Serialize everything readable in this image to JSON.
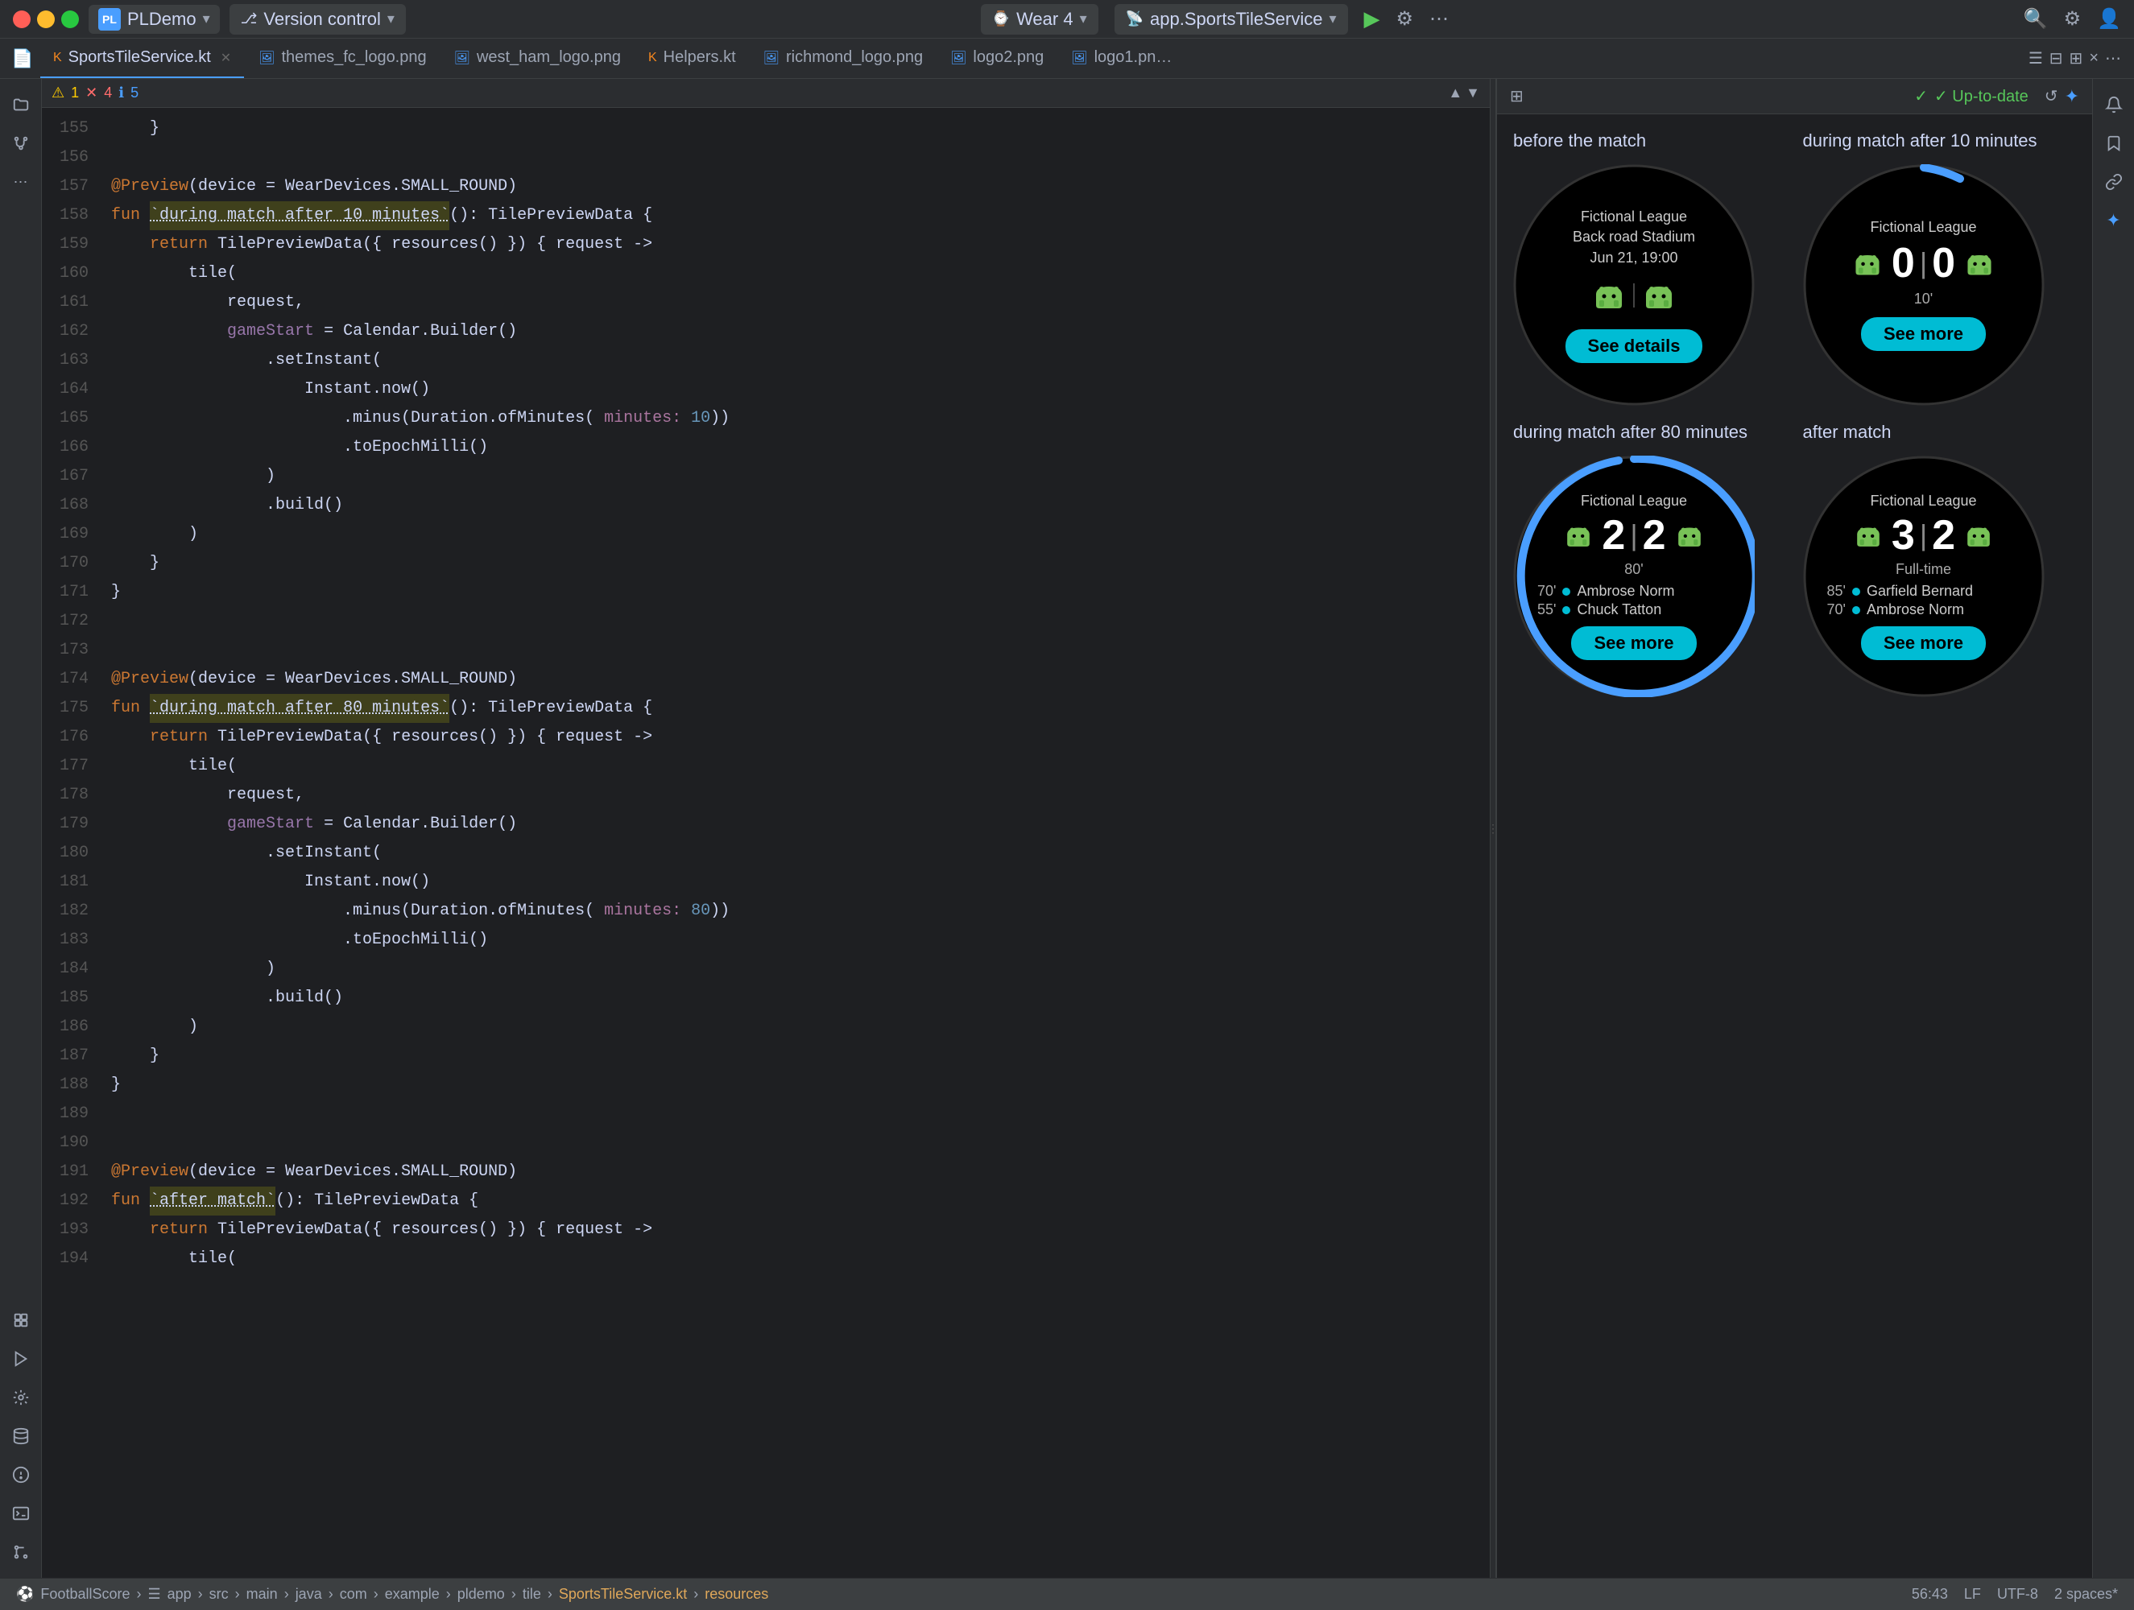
{
  "titlebar": {
    "traffic_lights": [
      "red",
      "yellow",
      "green"
    ],
    "project_label": "PLDemo",
    "version_control_label": "Version control",
    "wear_label": "Wear 4",
    "service_label": "app.SportsTileService",
    "run_icon": "▶",
    "debug_icon": "⚙",
    "more_icon": "⋯"
  },
  "tabs": [
    {
      "label": "SportsTileService.kt",
      "active": true,
      "closable": true,
      "icon": "kotlin"
    },
    {
      "label": "themes_fc_logo.png",
      "active": false,
      "closable": false,
      "icon": "image"
    },
    {
      "label": "west_ham_logo.png",
      "active": false,
      "closable": false,
      "icon": "image"
    },
    {
      "label": "Helpers.kt",
      "active": false,
      "closable": false,
      "icon": "kotlin"
    },
    {
      "label": "richmond_logo.png",
      "active": false,
      "closable": false,
      "icon": "image"
    },
    {
      "label": "logo2.png",
      "active": false,
      "closable": false,
      "icon": "image"
    },
    {
      "label": "logo1.pn…",
      "active": false,
      "closable": false,
      "icon": "image"
    }
  ],
  "editor": {
    "warnings": "1",
    "errors": "4",
    "infos": "5",
    "lines": [
      {
        "num": "155",
        "code": "    }",
        "tokens": [
          {
            "text": "    }",
            "class": "kw-normal"
          }
        ]
      },
      {
        "num": "156",
        "code": "",
        "tokens": []
      },
      {
        "num": "157",
        "code": "@Preview(device = WearDevices.SMALL_ROUND)",
        "tokens": [
          {
            "text": "@Preview",
            "class": "kw-annotation"
          },
          {
            "text": "(device = WearDevices.SMALL_ROUND)",
            "class": "kw-normal"
          }
        ]
      },
      {
        "num": "158",
        "code": "fun `during match after 10 minutes`(): TilePreviewData {",
        "tokens": [
          {
            "text": "fun",
            "class": "kw-fun"
          },
          {
            "text": " ",
            "class": "kw-normal"
          },
          {
            "text": "`during match after 10 minutes`",
            "class": "kw-highlight"
          },
          {
            "text": "(): TilePreviewData {",
            "class": "kw-normal"
          }
        ]
      },
      {
        "num": "159",
        "code": "    return TilePreviewData({ resources() }) { request ->",
        "tokens": [
          {
            "text": "    ",
            "class": "kw-normal"
          },
          {
            "text": "return",
            "class": "kw-return"
          },
          {
            "text": " TilePreviewData({ resources() }) { request ->",
            "class": "kw-normal"
          }
        ]
      },
      {
        "num": "160",
        "code": "        tile(",
        "tokens": [
          {
            "text": "        tile(",
            "class": "kw-normal"
          }
        ]
      },
      {
        "num": "161",
        "code": "            request,",
        "tokens": [
          {
            "text": "            request,",
            "class": "kw-normal"
          }
        ]
      },
      {
        "num": "162",
        "code": "            gameStart = Calendar.Builder()",
        "tokens": [
          {
            "text": "            ",
            "class": "kw-normal"
          },
          {
            "text": "gameStart",
            "class": "kw-param-name"
          },
          {
            "text": " = Calendar.Builder()",
            "class": "kw-normal"
          }
        ]
      },
      {
        "num": "163",
        "code": "                .setInstant(",
        "tokens": [
          {
            "text": "                .setInstant(",
            "class": "kw-normal"
          }
        ]
      },
      {
        "num": "164",
        "code": "                    Instant.now()",
        "tokens": [
          {
            "text": "                    Instant.now()",
            "class": "kw-normal"
          }
        ]
      },
      {
        "num": "165",
        "code": "                        .minus(Duration.ofMinutes( minutes: 10))",
        "tokens": [
          {
            "text": "                        .minus(Duration.ofMinutes(",
            "class": "kw-normal"
          },
          {
            "text": " minutes:",
            "class": "kw-param-label"
          },
          {
            "text": " 10",
            "class": "kw-number"
          },
          {
            "text": "))",
            "class": "kw-normal"
          }
        ]
      },
      {
        "num": "166",
        "code": "                        .toEpochMilli()",
        "tokens": [
          {
            "text": "                        .toEpochMilli()",
            "class": "kw-normal"
          }
        ]
      },
      {
        "num": "167",
        "code": "                )",
        "tokens": [
          {
            "text": "                )",
            "class": "kw-normal"
          }
        ]
      },
      {
        "num": "168",
        "code": "                .build()",
        "tokens": [
          {
            "text": "                .build()",
            "class": "kw-normal"
          }
        ]
      },
      {
        "num": "169",
        "code": "        )",
        "tokens": [
          {
            "text": "        )",
            "class": "kw-normal"
          }
        ]
      },
      {
        "num": "170",
        "code": "    }",
        "tokens": [
          {
            "text": "    }",
            "class": "kw-normal"
          }
        ]
      },
      {
        "num": "171",
        "code": "}",
        "tokens": [
          {
            "text": "}",
            "class": "kw-normal"
          }
        ]
      },
      {
        "num": "172",
        "code": "",
        "tokens": []
      },
      {
        "num": "173",
        "code": "",
        "tokens": []
      },
      {
        "num": "174",
        "code": "@Preview(device = WearDevices.SMALL_ROUND)",
        "tokens": [
          {
            "text": "@Preview",
            "class": "kw-annotation"
          },
          {
            "text": "(device = WearDevices.SMALL_ROUND)",
            "class": "kw-normal"
          }
        ]
      },
      {
        "num": "175",
        "code": "fun `during match after 80 minutes`(): TilePreviewData {",
        "tokens": [
          {
            "text": "fun",
            "class": "kw-fun"
          },
          {
            "text": " ",
            "class": "kw-normal"
          },
          {
            "text": "`during match after 80 minutes`",
            "class": "kw-highlight"
          },
          {
            "text": "(): TilePreviewData {",
            "class": "kw-normal"
          }
        ]
      },
      {
        "num": "176",
        "code": "    return TilePreviewData({ resources() }) { request ->",
        "tokens": [
          {
            "text": "    ",
            "class": "kw-normal"
          },
          {
            "text": "return",
            "class": "kw-return"
          },
          {
            "text": " TilePreviewData({ resources() }) { request ->",
            "class": "kw-normal"
          }
        ]
      },
      {
        "num": "177",
        "code": "        tile(",
        "tokens": [
          {
            "text": "        tile(",
            "class": "kw-normal"
          }
        ]
      },
      {
        "num": "178",
        "code": "            request,",
        "tokens": [
          {
            "text": "            request,",
            "class": "kw-normal"
          }
        ]
      },
      {
        "num": "179",
        "code": "            gameStart = Calendar.Builder()",
        "tokens": [
          {
            "text": "            ",
            "class": "kw-normal"
          },
          {
            "text": "gameStart",
            "class": "kw-param-name"
          },
          {
            "text": " = Calendar.Builder()",
            "class": "kw-normal"
          }
        ]
      },
      {
        "num": "180",
        "code": "                .setInstant(",
        "tokens": [
          {
            "text": "                .setInstant(",
            "class": "kw-normal"
          }
        ]
      },
      {
        "num": "181",
        "code": "                    Instant.now()",
        "tokens": [
          {
            "text": "                    Instant.now()",
            "class": "kw-normal"
          }
        ]
      },
      {
        "num": "182",
        "code": "                        .minus(Duration.ofMinutes( minutes: 80))",
        "tokens": [
          {
            "text": "                        .minus(Duration.ofMinutes(",
            "class": "kw-normal"
          },
          {
            "text": " minutes:",
            "class": "kw-param-label"
          },
          {
            "text": " 80",
            "class": "kw-number"
          },
          {
            "text": "))",
            "class": "kw-normal"
          }
        ]
      },
      {
        "num": "183",
        "code": "                        .toEpochMilli()",
        "tokens": [
          {
            "text": "                        .toEpochMilli()",
            "class": "kw-normal"
          }
        ]
      },
      {
        "num": "184",
        "code": "                )",
        "tokens": [
          {
            "text": "                )",
            "class": "kw-normal"
          }
        ]
      },
      {
        "num": "185",
        "code": "                .build()",
        "tokens": [
          {
            "text": "                .build()",
            "class": "kw-normal"
          }
        ]
      },
      {
        "num": "186",
        "code": "        )",
        "tokens": [
          {
            "text": "        )",
            "class": "kw-normal"
          }
        ]
      },
      {
        "num": "187",
        "code": "    }",
        "tokens": [
          {
            "text": "    }",
            "class": "kw-normal"
          }
        ]
      },
      {
        "num": "188",
        "code": "}",
        "tokens": [
          {
            "text": "}",
            "class": "kw-normal"
          }
        ]
      },
      {
        "num": "189",
        "code": "",
        "tokens": []
      },
      {
        "num": "190",
        "code": "",
        "tokens": []
      },
      {
        "num": "191",
        "code": "@Preview(device = WearDevices.SMALL_ROUND)",
        "tokens": [
          {
            "text": "@Preview",
            "class": "kw-annotation"
          },
          {
            "text": "(device = WearDevices.SMALL_ROUND)",
            "class": "kw-normal"
          }
        ]
      },
      {
        "num": "192",
        "code": "fun `after match`(): TilePreviewData {",
        "tokens": [
          {
            "text": "fun",
            "class": "kw-fun"
          },
          {
            "text": " ",
            "class": "kw-normal"
          },
          {
            "text": "`after match`",
            "class": "kw-highlight"
          },
          {
            "text": "(): TilePreviewData {",
            "class": "kw-normal"
          }
        ]
      },
      {
        "num": "193",
        "code": "    return TilePreviewData({ resources() }) { request ->",
        "tokens": [
          {
            "text": "    ",
            "class": "kw-normal"
          },
          {
            "text": "return",
            "class": "kw-return"
          },
          {
            "text": " TilePreviewData({ resources() }) { request ->",
            "class": "kw-normal"
          }
        ]
      },
      {
        "num": "194",
        "code": "        tile(",
        "tokens": [
          {
            "text": "        tile(",
            "class": "kw-normal"
          }
        ]
      }
    ]
  },
  "preview": {
    "up_to_date_label": "✓ Up-to-date",
    "sections": [
      {
        "label": "before the match",
        "type": "before_match",
        "watch": {
          "league": "Fictional League",
          "venue": "Back road Stadium",
          "date": "Jun 21, 19:00",
          "button_label": "See details",
          "show_ring": false
        }
      },
      {
        "label": "during match after 10 minutes",
        "type": "during_10",
        "watch": {
          "league": "Fictional League",
          "score_home": "0",
          "score_away": "0",
          "minute": "10'",
          "button_label": "See more",
          "show_ring": true,
          "ring_progress": 0.15
        }
      },
      {
        "label": "during match after 80 minutes",
        "type": "during_80",
        "watch": {
          "league": "Fictional League",
          "score_home": "2",
          "score_away": "2",
          "minute": "80'",
          "button_label": "See more",
          "show_ring": true,
          "ring_progress": 0.9,
          "scorer1_min": "70'",
          "scorer1_name": "Ambrose Norm",
          "scorer2_min": "55'",
          "scorer2_name": "Chuck Tatton"
        }
      },
      {
        "label": "after match",
        "type": "after_match",
        "watch": {
          "league": "Fictional League",
          "score_home": "3",
          "score_away": "2",
          "status": "Full-time",
          "button_label": "See more",
          "show_ring": false,
          "scorer1_min": "85'",
          "scorer1_name": "Garfield Bernard",
          "scorer2_min": "70'",
          "scorer2_name": "Ambrose Norm"
        }
      }
    ]
  },
  "statusbar": {
    "breadcrumb": "⚽ FootballScore › ☰ app › ✦ src › ✦ main › ✦ java › ✦ com › ✦ example › ✦ pldemo › ✦ tile › ⊙ SportsTileService.kt › ⊙ resources",
    "position": "56:43",
    "encoding": "LF",
    "charset": "UTF-8",
    "indent": "2 spaces*"
  },
  "sidebar_icons": [
    {
      "name": "folder-icon",
      "symbol": "📁",
      "active": false
    },
    {
      "name": "git-icon",
      "symbol": "⎇",
      "active": false
    },
    {
      "name": "more-icon",
      "symbol": "⋯",
      "active": false
    },
    {
      "name": "plugins-icon",
      "symbol": "🔌",
      "active": false
    },
    {
      "name": "run-icon",
      "symbol": "▶",
      "active": false
    },
    {
      "name": "design-icon",
      "symbol": "◈",
      "active": false
    },
    {
      "name": "db-icon",
      "symbol": "🗄",
      "active": false
    },
    {
      "name": "warning-icon",
      "symbol": "⚠",
      "active": false
    },
    {
      "name": "terminal-icon",
      "symbol": "⊞",
      "active": false
    },
    {
      "name": "git2-icon",
      "symbol": "⎇",
      "active": false
    }
  ]
}
